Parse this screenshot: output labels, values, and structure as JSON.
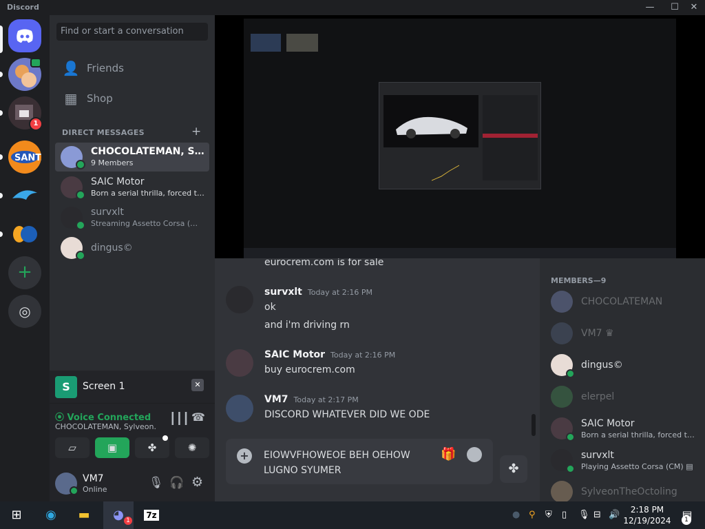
{
  "window": {
    "app_name": "Discord",
    "minimize": "—",
    "maximize": "☐",
    "close": "✕"
  },
  "sidebar": {
    "search_placeholder": "Find or start a conversation",
    "nav": [
      {
        "label": "Friends"
      },
      {
        "label": "Shop"
      }
    ],
    "dm_header": "DIRECT MESSAGES",
    "dm_add": "+",
    "dms": [
      {
        "name": "CHOCOLATEMAN, Sylveon…",
        "sub": "9 Members"
      },
      {
        "name": "SAIC Motor",
        "sub": "Born a serial thrilla, forced to …"
      },
      {
        "name": "survxlt",
        "sub": "Streaming Assetto Corsa (… ▤"
      },
      {
        "name": "dingus©",
        "sub": ""
      }
    ]
  },
  "servers": {
    "badge_count": "1",
    "notify_badge": "1"
  },
  "screen_panel": {
    "label": "Screen 1"
  },
  "voice_panel": {
    "status": "Voice Connected",
    "channel": "CHOCOLATEMAN, Sylveon…"
  },
  "user_panel": {
    "name": "VM7",
    "status": "Online"
  },
  "chat": {
    "cut_line": "eurocrem.com is for sale",
    "messages": [
      {
        "author": "survxlt",
        "time": "Today at 2:16 PM",
        "lines": [
          "ok",
          "and i'm driving rn"
        ]
      },
      {
        "author": "SAIC Motor",
        "time": "Today at 2:16 PM",
        "lines": [
          "buy eurocrem.com"
        ]
      },
      {
        "author": "VM7",
        "time": "Today at 2:17 PM",
        "lines": [
          "DISCORD WHATEVER DID  WE ODE"
        ]
      }
    ],
    "composer_text": "EIOWVFHOWEOE BEH OEHOW LUGNO SYUMER"
  },
  "members": {
    "header": "MEMBERS—9",
    "list": [
      {
        "name": "CHOCOLATEMAN",
        "sub": ""
      },
      {
        "name": "VM7 ♛",
        "sub": ""
      },
      {
        "name": "dingus©",
        "sub": ""
      },
      {
        "name": "elerpel",
        "sub": ""
      },
      {
        "name": "SAIC Motor",
        "sub": "Born a serial thrilla, forced to …"
      },
      {
        "name": "survxlt",
        "sub": "Playing Assetto Corsa (CM) ▤"
      },
      {
        "name": "SylveonTheOctoling",
        "sub": ""
      }
    ]
  },
  "taskbar": {
    "time": "2:18 PM",
    "date": "12/19/2024",
    "notification_count": "1",
    "discord_badge": "1"
  },
  "colors": {
    "accent": "#5865f2",
    "green": "#23a55a",
    "red": "#f23f43",
    "bg": "#313338"
  }
}
